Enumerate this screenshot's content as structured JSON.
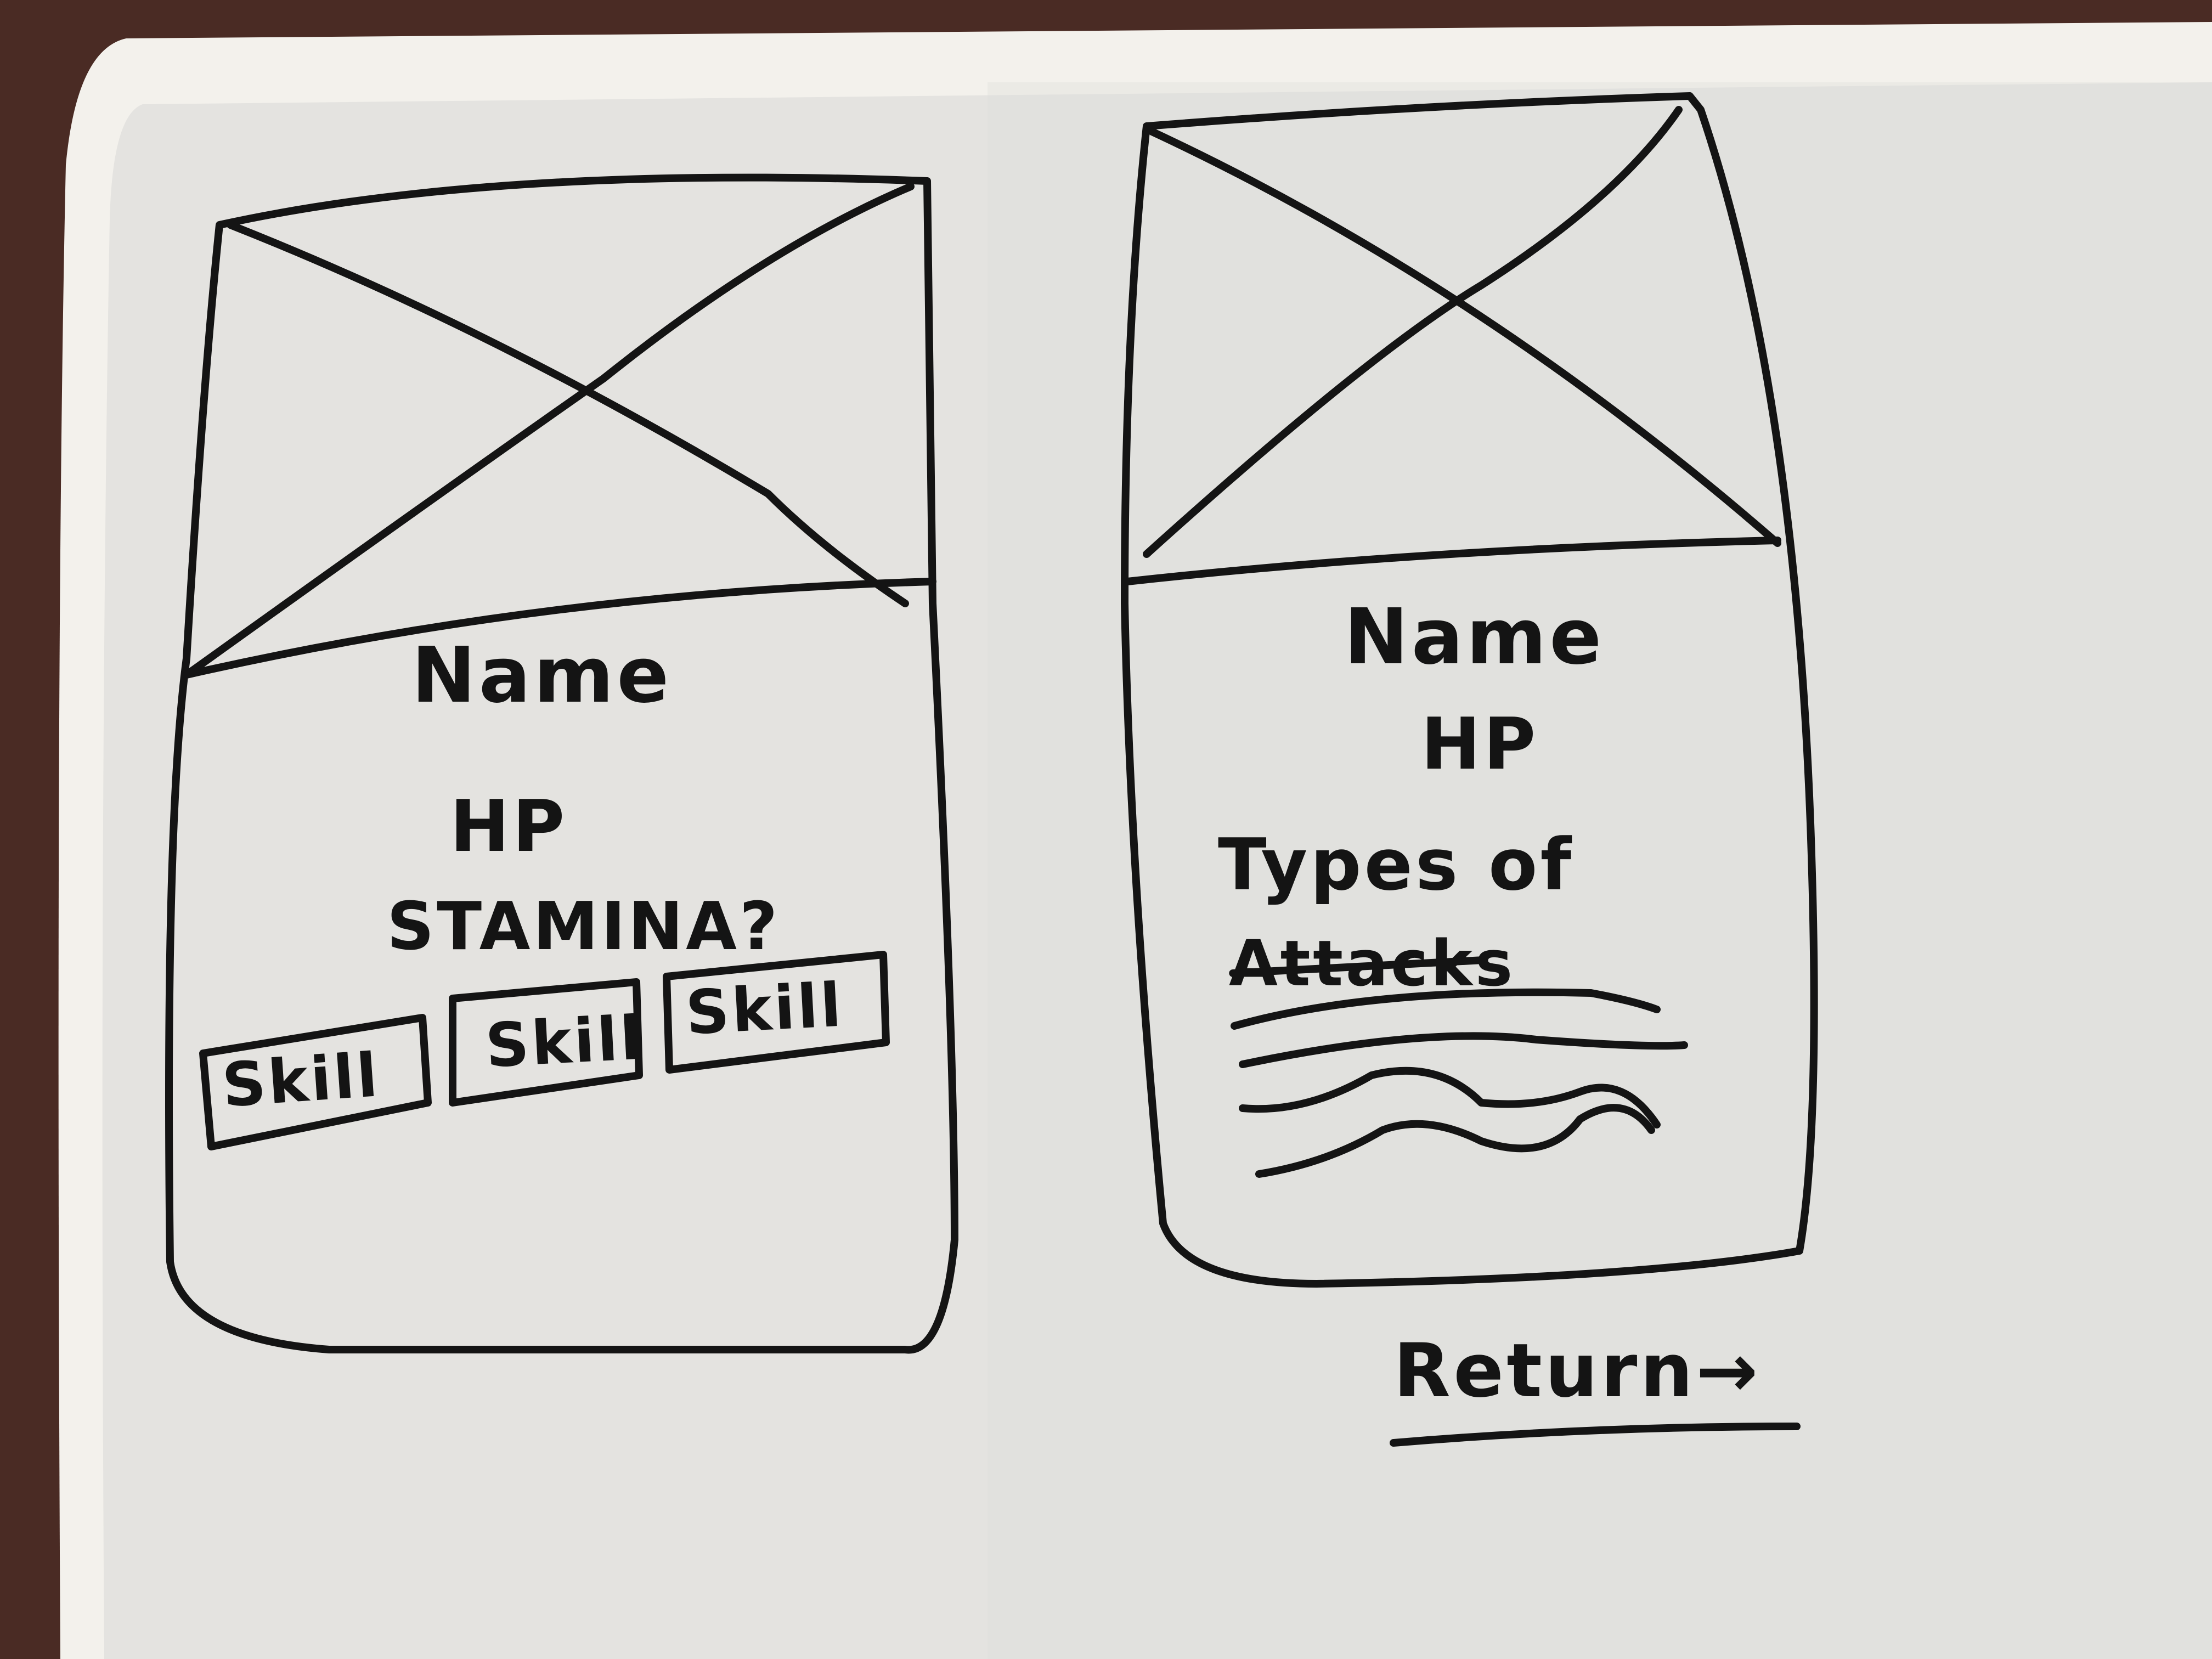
{
  "colors": {
    "board": "#e4e3e0",
    "frame": "#f3f1ec",
    "marker": "#141414",
    "background": "#4a2b24"
  },
  "left_card": {
    "name": "Name",
    "hp": "HP",
    "stamina": "STAMINA?",
    "skills": [
      "Skill",
      "Skill",
      "Skill"
    ]
  },
  "right_card": {
    "name": "Name",
    "hp": "HP",
    "types_line1": "Types of",
    "types_line2": "Attacks"
  },
  "return_label": "Return→",
  "icons": [
    "image-placeholder-icon",
    "image-placeholder-icon",
    "squiggle-line-icon",
    "arrow-right-icon"
  ]
}
